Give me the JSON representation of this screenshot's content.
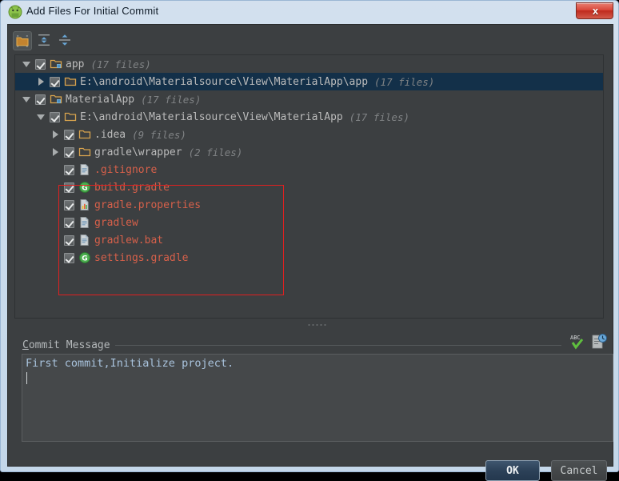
{
  "window": {
    "title": "Add Files For Initial Commit",
    "app_icon": "android-head-icon",
    "close_label": "x"
  },
  "toolbar": {
    "buttons": [
      {
        "name": "group-by-directory-toggle",
        "icon": "folder-icon",
        "selected": true
      },
      {
        "name": "expand-all-button",
        "icon": "expand-all-icon",
        "selected": false
      },
      {
        "name": "collapse-all-button",
        "icon": "collapse-all-icon",
        "selected": false
      }
    ]
  },
  "tree": {
    "rows": [
      {
        "indent": 0,
        "twisty": "down",
        "checked": true,
        "icon": "module-folder-icon",
        "label": "app",
        "count": "(17 files)",
        "red": false,
        "selected": false
      },
      {
        "indent": 1,
        "twisty": "right",
        "checked": true,
        "icon": "folder-icon",
        "label": "E:\\android\\Materialsource\\View\\MaterialApp\\app",
        "count": "(17 files)",
        "red": false,
        "selected": true
      },
      {
        "indent": 0,
        "twisty": "down",
        "checked": true,
        "icon": "module-folder-icon",
        "label": "MaterialApp",
        "count": "(17 files)",
        "red": false,
        "selected": false
      },
      {
        "indent": 1,
        "twisty": "down",
        "checked": true,
        "icon": "folder-icon",
        "label": "E:\\android\\Materialsource\\View\\MaterialApp",
        "count": "(17 files)",
        "red": false,
        "selected": false
      },
      {
        "indent": 2,
        "twisty": "right",
        "checked": true,
        "icon": "folder-icon",
        "label": ".idea",
        "count": "(9 files)",
        "red": false,
        "selected": false
      },
      {
        "indent": 2,
        "twisty": "right",
        "checked": true,
        "icon": "folder-icon",
        "label": "gradle\\wrapper",
        "count": "(2 files)",
        "red": false,
        "selected": false
      },
      {
        "indent": 2,
        "twisty": "none",
        "checked": true,
        "icon": "text-file-icon",
        "label": ".gitignore",
        "count": "",
        "red": true,
        "selected": false
      },
      {
        "indent": 2,
        "twisty": "none",
        "checked": true,
        "icon": "gradle-file-icon",
        "label": "build.gradle",
        "count": "",
        "red": true,
        "selected": false
      },
      {
        "indent": 2,
        "twisty": "none",
        "checked": true,
        "icon": "properties-file-icon",
        "label": "gradle.properties",
        "count": "",
        "red": true,
        "selected": false
      },
      {
        "indent": 2,
        "twisty": "none",
        "checked": true,
        "icon": "text-file-icon",
        "label": "gradlew",
        "count": "",
        "red": true,
        "selected": false
      },
      {
        "indent": 2,
        "twisty": "none",
        "checked": true,
        "icon": "text-file-icon",
        "label": "gradlew.bat",
        "count": "",
        "red": true,
        "selected": false
      },
      {
        "indent": 2,
        "twisty": "none",
        "checked": true,
        "icon": "gradle-file-icon",
        "label": "settings.gradle",
        "count": "",
        "red": true,
        "selected": false
      }
    ]
  },
  "annotation": {
    "name": "red-highlight-box",
    "color": "#e02020"
  },
  "commit": {
    "label_mnemonic": "C",
    "label_rest": "ommit Message",
    "text": "First commit,Initialize project.",
    "spellcheck_icon": "abc-spellcheck-icon",
    "history_icon": "commit-history-icon"
  },
  "footer": {
    "ok_label": "OK",
    "cancel_label": "Cancel"
  },
  "colors": {
    "panel_bg": "#3c3f41",
    "selection": "#133049",
    "accent_red": "#d6604a",
    "titlebar": "#cbdcec"
  }
}
